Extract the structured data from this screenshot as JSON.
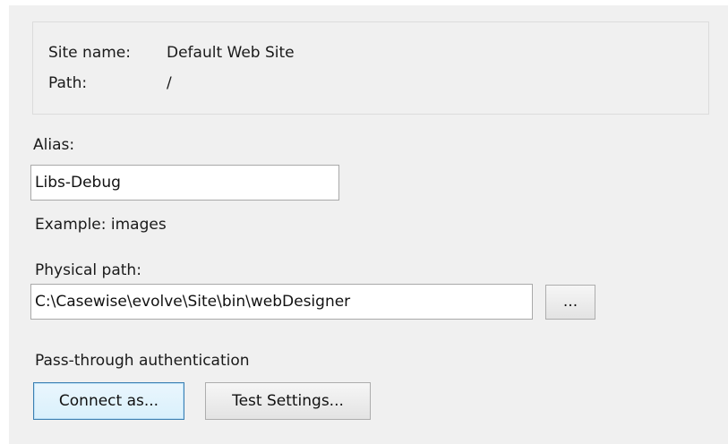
{
  "site_info": {
    "site_name_label": "Site name:",
    "site_name_value": "Default Web Site",
    "path_label": "Path:",
    "path_value": "/"
  },
  "alias": {
    "label": "Alias:",
    "value": "Libs-Debug",
    "example": "Example: images"
  },
  "physical_path": {
    "label": "Physical path:",
    "value": "C:\\Casewise\\evolve\\Site\\bin\\webDesigner",
    "browse_label": "..."
  },
  "auth": {
    "label": "Pass-through authentication",
    "connect_as_label": "Connect as...",
    "test_settings_label": "Test Settings..."
  }
}
